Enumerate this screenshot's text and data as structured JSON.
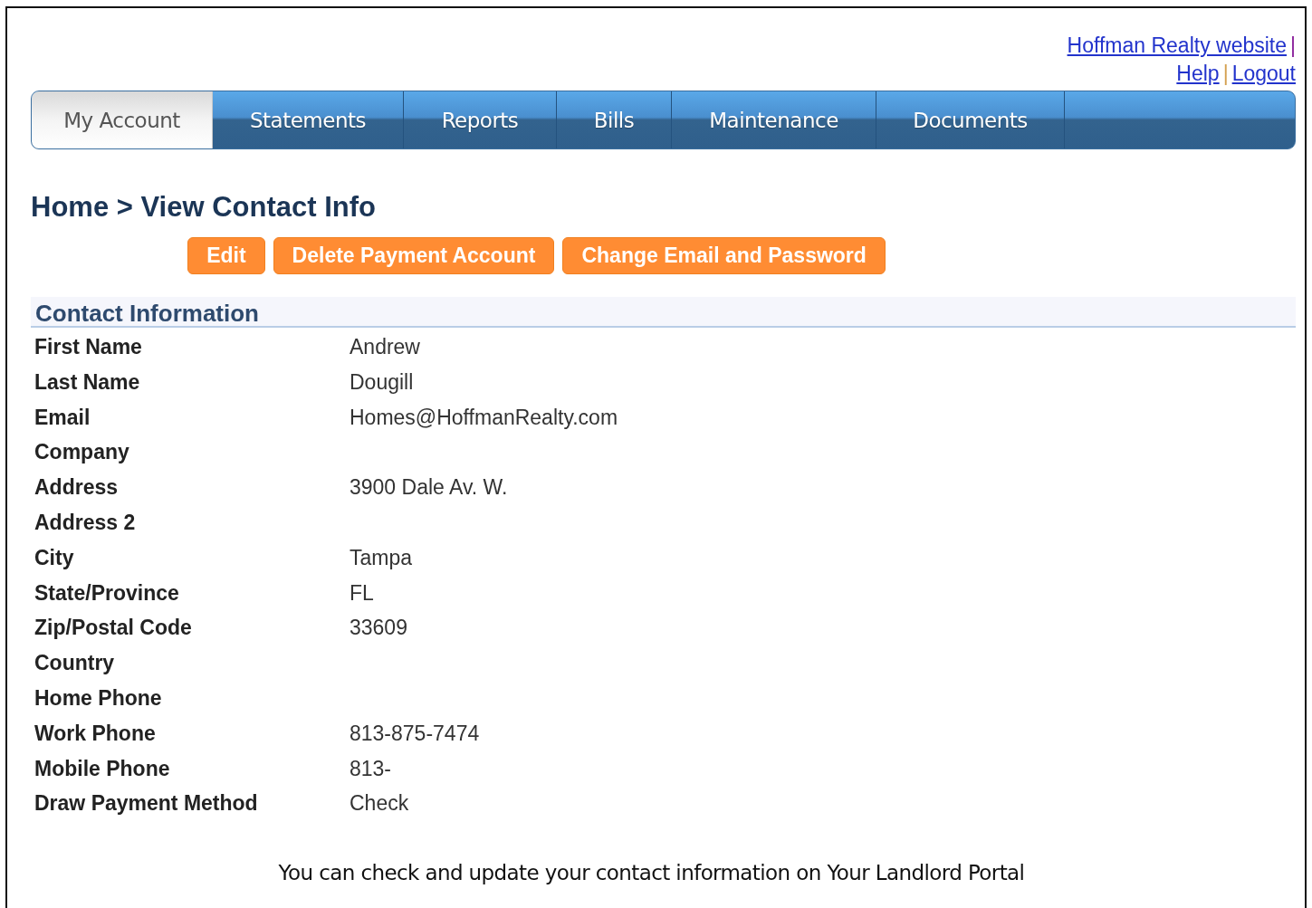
{
  "top_links": [
    {
      "label": "Hoffman Realty website",
      "separator": "|"
    },
    {
      "label": "Help",
      "separator": "|"
    },
    {
      "label": "Logout"
    }
  ],
  "tabs": [
    {
      "label": "My Account",
      "selected": true
    },
    {
      "label": "Statements",
      "selected": false
    },
    {
      "label": "Reports",
      "selected": false
    },
    {
      "label": "Bills",
      "selected": false
    },
    {
      "label": "Maintenance",
      "selected": false
    },
    {
      "label": "Documents",
      "selected": false
    }
  ],
  "breadcrumb": "Home > View Contact Info",
  "buttons": [
    "Edit",
    "Delete Payment Account",
    "Change Email and Password"
  ],
  "section": {
    "title": "Contact Information",
    "rows": [
      {
        "label": "First Name",
        "value": "Andrew"
      },
      {
        "label": "Last Name",
        "value": "Dougill"
      },
      {
        "label": "Email",
        "value": "Homes@HoffmanRealty.com"
      },
      {
        "label": "Company"
      },
      {
        "label": "Address",
        "value": "3900 Dale Av. W."
      },
      {
        "label": "Address 2"
      },
      {
        "label": "City",
        "value": "Tampa"
      },
      {
        "label": "State/Province",
        "value": "FL"
      },
      {
        "label": "Zip/Postal Code",
        "value": "33609"
      },
      {
        "label": "Country"
      },
      {
        "label": "Home Phone"
      },
      {
        "label": "Work Phone",
        "value": "813-875-7474"
      },
      {
        "label": "Mobile Phone",
        "value": "813-"
      },
      {
        "label": "Draw Payment Method",
        "value": "Check"
      }
    ]
  },
  "caption": "You can check and update your contact information on Your Landlord Portal"
}
